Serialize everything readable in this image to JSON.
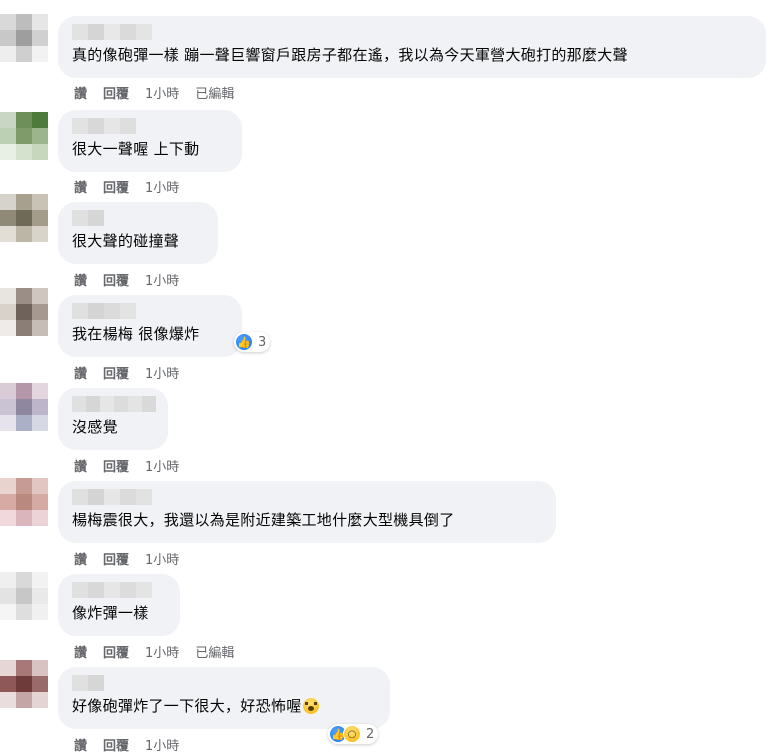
{
  "actions": {
    "like": "讚",
    "reply": "回覆",
    "edited": "已編輯"
  },
  "comments": [
    {
      "text": "真的像砲彈一樣 蹦一聲巨響窗戶跟房子都在遙，我以為今天軍營大砲打的那麼大聲",
      "time": "1小時",
      "edited": true
    },
    {
      "text": "很大一聲喔 上下動",
      "time": "1小時",
      "edited": false
    },
    {
      "text": "很大聲的碰撞聲",
      "time": "1小時",
      "edited": false
    },
    {
      "text": "我在楊梅 很像爆炸",
      "time": "1小時",
      "edited": false,
      "reaction_count": "3"
    },
    {
      "text": "沒感覺",
      "time": "1小時",
      "edited": false
    },
    {
      "text": "楊梅震很大，我還以為是附近建築工地什麼大型機具倒了",
      "time": "1小時",
      "edited": false
    },
    {
      "text": "像炸彈一樣",
      "time": "1小時",
      "edited": true
    },
    {
      "text": "好像砲彈炸了一下很大，好恐怖喔",
      "time": "1小時",
      "edited": false,
      "reaction_count": "2"
    }
  ]
}
